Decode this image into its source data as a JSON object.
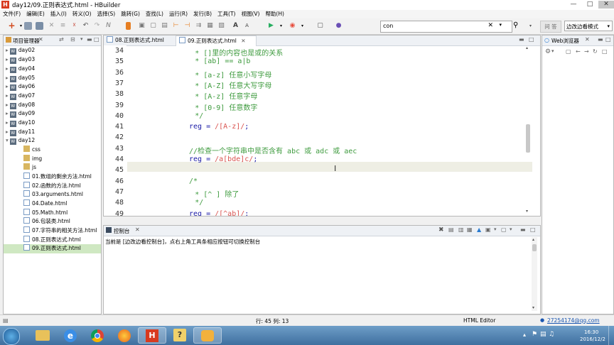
{
  "window": {
    "title": "day12/09.正则表达式.html  -  HBuilder",
    "logo": "H"
  },
  "menu": [
    "文件(F)",
    "编辑(E)",
    "插入(I)",
    "转义(O)",
    "选择(S)",
    "跳转(G)",
    "查找(L)",
    "运行(R)",
    "发行(B)",
    "工具(T)",
    "视图(V)",
    "帮助(H)"
  ],
  "toolbar": {
    "search_value": "con",
    "ask_label": "问 答",
    "mode_label": "边改边看模式"
  },
  "project_panel": {
    "title": "项目管理器",
    "projects": [
      "day02",
      "day03",
      "day04",
      "day05",
      "day06",
      "day07",
      "day08",
      "day09",
      "day10",
      "day11",
      "day12"
    ],
    "day12_children": [
      "css",
      "img",
      "js",
      "01.数组的剩余方法.html",
      "02.函数的方法.html",
      "03.arguments.html",
      "04.Date.html",
      "05.Math.html",
      "06.包装类.html",
      "07.字符串的相关方法.html",
      "08.正则表达式.html",
      "09.正则表达式.html"
    ]
  },
  "editor": {
    "tabs": [
      "08.正则表达式.html",
      "09.正则表达式.html"
    ],
    "active_tab": 1,
    "lines": [
      {
        "n": "34",
        "parts": [
          {
            "t": "* []里的内容也是或的关系",
            "c": "cm"
          }
        ],
        "indent": 11
      },
      {
        "n": "35",
        "parts": [
          {
            "t": "* [ab] == a|b",
            "c": "cm"
          }
        ],
        "indent": 11
      },
      {
        "n": "36",
        "parts": [
          {
            "t": "* [a-z] 任意小写字母",
            "c": "cm"
          }
        ],
        "indent": 11
      },
      {
        "n": "37",
        "parts": [
          {
            "t": "* [A-Z] 任意大写字母",
            "c": "cm"
          }
        ],
        "indent": 11
      },
      {
        "n": "38",
        "parts": [
          {
            "t": "* [A-z] 任意字母",
            "c": "cm"
          }
        ],
        "indent": 11
      },
      {
        "n": "39",
        "parts": [
          {
            "t": "* [0-9] 任意数字",
            "c": "cm"
          }
        ],
        "indent": 11
      },
      {
        "n": "40",
        "parts": [
          {
            "t": "*/",
            "c": "cm"
          }
        ],
        "indent": 11
      },
      {
        "n": "41",
        "parts": [
          {
            "t": "reg = ",
            "c": "kw"
          },
          {
            "t": "/[A-z]/",
            "c": "rx"
          },
          {
            "t": ";",
            "c": "kw"
          }
        ],
        "indent": 10
      },
      {
        "n": "42",
        "parts": [],
        "indent": 10
      },
      {
        "n": "43",
        "parts": [
          {
            "t": "//检查一个字符串中是否含有 abc 或 adc 或 aec",
            "c": "cm"
          }
        ],
        "indent": 10
      },
      {
        "n": "44",
        "parts": [
          {
            "t": "reg = ",
            "c": "kw"
          },
          {
            "t": "/a[bde]c/",
            "c": "rx"
          },
          {
            "t": ";",
            "c": "kw"
          }
        ],
        "indent": 10
      },
      {
        "n": "45",
        "parts": [],
        "indent": 10
      },
      {
        "n": "46",
        "parts": [
          {
            "t": "/*",
            "c": "cm"
          }
        ],
        "indent": 10
      },
      {
        "n": "47",
        "parts": [
          {
            "t": "* [^ ] 除了",
            "c": "cm"
          }
        ],
        "indent": 11
      },
      {
        "n": "48",
        "parts": [
          {
            "t": "*/",
            "c": "cm"
          }
        ],
        "indent": 11
      },
      {
        "n": "49",
        "parts": [
          {
            "t": "reg = ",
            "c": "kw"
          },
          {
            "t": "/[^ab]/",
            "c": "rx"
          },
          {
            "t": ";",
            "c": "kw"
          }
        ],
        "indent": 10
      }
    ]
  },
  "right_panel": {
    "title": "Web浏览器"
  },
  "console": {
    "title": "控制台",
    "message": "当前是 [边改边看控制台]，点右上角工具条相应按钮可切换控制台"
  },
  "status": {
    "position": "行: 45 列: 13",
    "editor_type": "HTML Editor",
    "user": "27254174@qq.com"
  },
  "taskbar": {
    "time": "16:30",
    "date": "2016/12/2"
  }
}
